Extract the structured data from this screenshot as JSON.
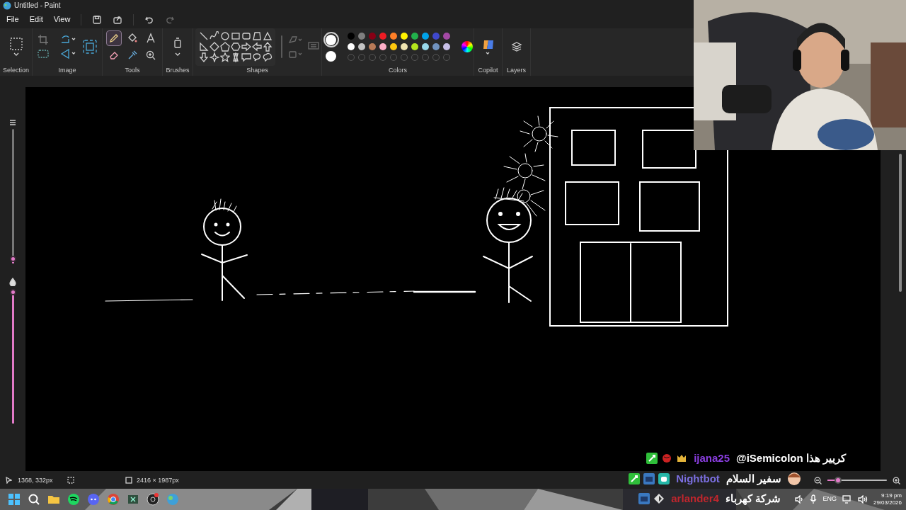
{
  "window": {
    "title": "Untitled - Paint"
  },
  "menu": [
    {
      "label": "File"
    },
    {
      "label": "Edit"
    },
    {
      "label": "View"
    }
  ],
  "ribbon": [
    {
      "kind": "selection",
      "label": "Selection"
    },
    {
      "label": "Image"
    },
    {
      "kind": "tools",
      "label": "Tools"
    },
    {
      "kind": "brushes",
      "label": "Brushes"
    },
    {
      "kind": "shapes",
      "label": "Shapes"
    },
    {
      "kind": "colors",
      "label": "Colors"
    },
    {
      "kind": "copilot",
      "label": "Copilot"
    },
    {
      "kind": "layers",
      "label": "Layers"
    }
  ],
  "tools": [
    {
      "kind": "pencil",
      "selected": true
    },
    {
      "kind": "fill",
      "selected": false
    },
    {
      "kind": "text",
      "selected": false
    },
    {
      "kind": "eraser",
      "selected": false
    },
    {
      "kind": "picker",
      "selected": false
    },
    {
      "kind": "magnifier",
      "selected": false
    }
  ],
  "colors": {
    "palette": [
      {
        "color": "#000000"
      },
      {
        "color": "#7f7f7f"
      },
      {
        "color": "#880015"
      },
      {
        "color": "#ed1c24"
      },
      {
        "color": "#ff7f27"
      },
      {
        "color": "#fff200"
      },
      {
        "color": "#22b14c"
      },
      {
        "color": "#00a2e8"
      },
      {
        "color": "#3f48cc"
      },
      {
        "color": "#a349a4"
      },
      {
        "color": "#ffffff"
      },
      {
        "color": "#c3c3c3"
      },
      {
        "color": "#b97a57"
      },
      {
        "color": "#ffaec9"
      },
      {
        "color": "#ffc90e"
      },
      {
        "color": "#efe4b0"
      },
      {
        "color": "#b5e61d"
      },
      {
        "color": "#99d9ea"
      },
      {
        "color": "#7092be"
      },
      {
        "color": "#c8bfe7"
      }
    ]
  },
  "side_sliders": [
    {
      "kind": "size",
      "level": 0.03
    },
    {
      "kind": "opacity",
      "level": 0.97
    }
  ],
  "status_bar": {
    "cursor": "1368, 332px",
    "canvas_size": "2416 × 1987px",
    "zoom_slider": {
      "level": 0.18
    }
  },
  "chat": [
    {
      "user": "ijana25",
      "color": "#8a3ee0",
      "message": "@iSemicolon كريير هذا"
    },
    {
      "user": "Nightbot",
      "color": "#7b6fe0",
      "message": "سفير السلام"
    },
    {
      "user": "arlander4",
      "color": "#c0262d",
      "message": "شركة كهرباء"
    }
  ],
  "taskbar": {
    "language": "ENG",
    "time": "9:19 pm",
    "date": "29/03/2026"
  }
}
